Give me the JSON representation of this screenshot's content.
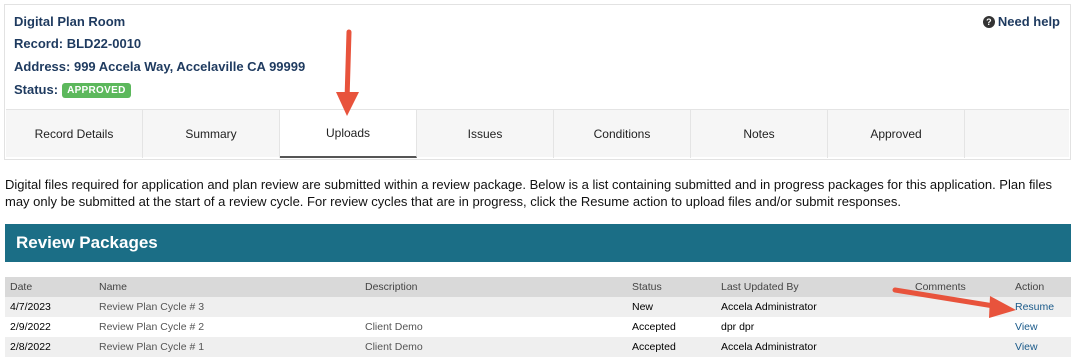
{
  "header": {
    "title": "Digital Plan Room",
    "record_label": "Record: BLD22-0010",
    "address_label": "Address: 999 Accela Way, Accelaville CA 99999",
    "status_label": "Status:",
    "status_badge": "APPROVED",
    "help_label": "Need help",
    "help_icon": "?"
  },
  "tabs": [
    "Record Details",
    "Summary",
    "Uploads",
    "Issues",
    "Conditions",
    "Notes",
    "Approved"
  ],
  "active_tab": "Uploads",
  "description": "Digital files required for application and plan review are submitted within a review package. Below is a list containing submitted and in progress packages for this application. Plan files may only be submitted at the start of a review cycle. For review cycles that are in progress, click the Resume action to upload files and/or submit responses.",
  "section_title": "Review Packages",
  "table": {
    "columns": [
      "Date",
      "Name",
      "Description",
      "Status",
      "Last Updated By",
      "Comments",
      "Action"
    ],
    "rows": [
      {
        "date": "4/7/2023",
        "name": "Review Plan Cycle # 3",
        "description": "",
        "status": "New",
        "updated_by": "Accela Administrator",
        "comments": "",
        "action": "Resume"
      },
      {
        "date": "2/9/2022",
        "name": "Review Plan Cycle # 2",
        "description": "Client Demo",
        "status": "Accepted",
        "updated_by": "dpr dpr",
        "comments": "",
        "action": "View"
      },
      {
        "date": "2/8/2022",
        "name": "Review Plan Cycle # 1",
        "description": "Client Demo",
        "status": "Accepted",
        "updated_by": "Accela Administrator",
        "comments": "",
        "action": "View"
      }
    ]
  },
  "colors": {
    "banner": "#1b6e86",
    "badge": "#5cb85c",
    "heading_text": "#1e3a5f",
    "annotation_arrow": "#e8533c"
  }
}
